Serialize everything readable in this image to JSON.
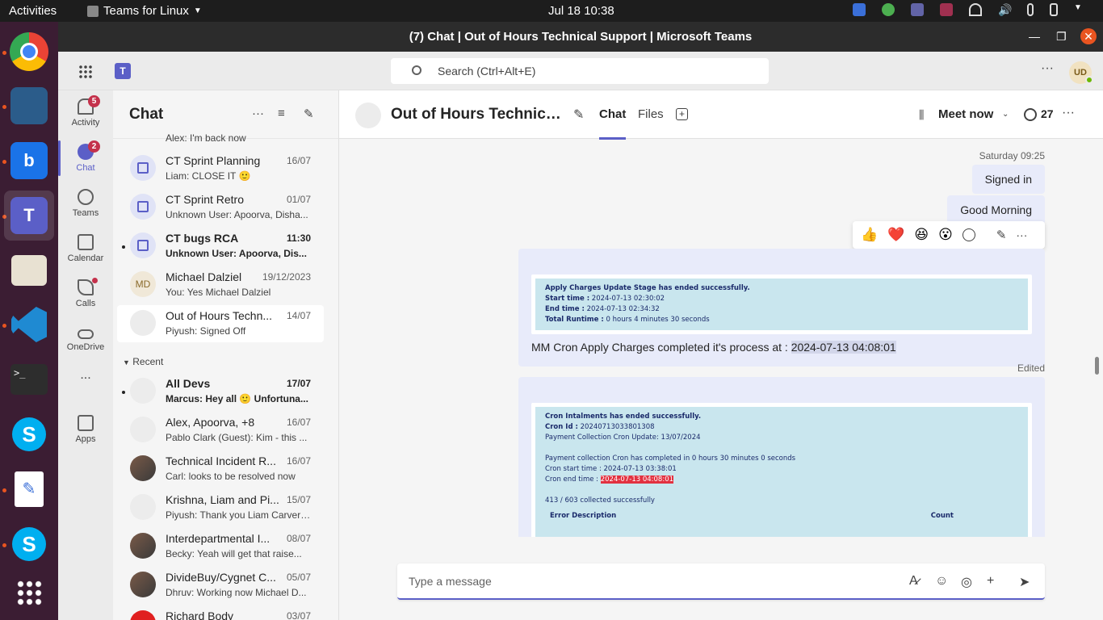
{
  "gnome": {
    "activities": "Activities",
    "app_menu": "Teams for Linux",
    "clock": "Jul 18  10:38"
  },
  "window": {
    "title": "(7) Chat | Out of Hours Technical Support | Microsoft Teams"
  },
  "teams": {
    "search_placeholder": "Search (Ctrl+Alt+E)",
    "avatar_initials": "UD"
  },
  "rail": {
    "items": [
      {
        "label": "Activity",
        "badge": "5"
      },
      {
        "label": "Chat",
        "badge": "2"
      },
      {
        "label": "Teams"
      },
      {
        "label": "Calendar"
      },
      {
        "label": "Calls"
      },
      {
        "label": "OneDrive"
      },
      {
        "label": "..."
      },
      {
        "label": "Apps"
      }
    ]
  },
  "chatlist": {
    "title": "Chat",
    "partial_preview": "Alex: I'm back now",
    "pinned": [
      {
        "name": "CT Sprint Planning",
        "time": "16/07",
        "preview": "Liam: CLOSE IT 🙂"
      },
      {
        "name": "CT Sprint Retro",
        "time": "01/07",
        "preview": "Unknown User: Apoorva, Disha..."
      },
      {
        "name": "CT bugs RCA",
        "time": "11:30",
        "preview": "Unknown User: Apoorva, Dis..."
      },
      {
        "name": "Michael Dalziel",
        "time": "19/12/2023",
        "preview": "You: Yes Michael Dalziel",
        "initials": "MD"
      },
      {
        "name": "Out of Hours Techn...",
        "time": "14/07",
        "preview": "Piyush: Signed Off"
      }
    ],
    "recent_label": "Recent",
    "recent": [
      {
        "name": "All Devs",
        "time": "17/07",
        "preview": "Marcus: Hey all 🙂 Unfortuna..."
      },
      {
        "name": "Alex, Apoorva, +8",
        "time": "16/07",
        "preview": "Pablo Clark (Guest): Kim - this ..."
      },
      {
        "name": "Technical Incident R...",
        "time": "16/07",
        "preview": "Carl: looks to be resolved now"
      },
      {
        "name": "Krishna, Liam and Pi...",
        "time": "15/07",
        "preview": "Piyush: Thank you Liam Carver-..."
      },
      {
        "name": "Interdepartmental I...",
        "time": "08/07",
        "preview": "Becky: Yeah will get that raise..."
      },
      {
        "name": "DivideBuy/Cygnet C...",
        "time": "05/07",
        "preview": "Dhruv: Working now Michael D..."
      },
      {
        "name": "Richard Body",
        "time": "03/07",
        "preview": ""
      }
    ]
  },
  "conversation": {
    "title": "Out of Hours Technical ...",
    "tabs": [
      "Chat",
      "Files"
    ],
    "meet_now": "Meet now",
    "participant_count": "27",
    "timestamp": "Saturday 09:25",
    "bubbles": [
      "Signed in",
      "Good Morning"
    ],
    "reactions": [
      "👍",
      "❤️",
      "😆",
      "😮"
    ],
    "card1": {
      "line1": "Apply Charges Update Stage has ended successfully.",
      "start_label": "Start time :",
      "start": "2024-07-13 02:30:02",
      "end_label": "End time :",
      "end": "2024-07-13 02:34:32",
      "runtime_label": "Total Runtime :",
      "runtime": "0 hours 4 minutes 30 seconds"
    },
    "msg1_prefix": "MM Cron Apply Charges completed it's process at : ",
    "msg1_highlight": "2024-07-13 04:08:01",
    "edited": "Edited",
    "card2": {
      "line1": "Cron Intalments has ended successfully.",
      "cron_id_label": "Cron Id :",
      "cron_id": "20240713033801308",
      "payment_update": "Payment Collection Cron Update: 13/07/2024",
      "completed": "Payment collection Cron has completed in 0 hours 30 minutes 0 seconds",
      "start": "Cron start time : 2024-07-13 03:38:01",
      "end_label": "Cron end time :",
      "end": "2024-07-13 04:08:01",
      "collected": "413 / 603 collected successfully",
      "col1": "Error Description",
      "col2": "Count"
    },
    "compose_placeholder": "Type a message"
  }
}
